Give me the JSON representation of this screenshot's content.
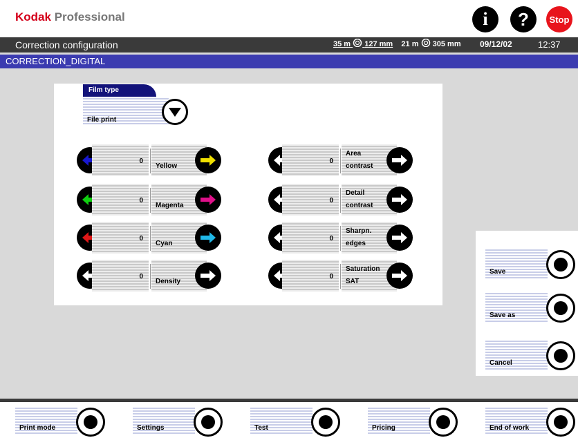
{
  "header": {
    "brand_bold": "Kodak",
    "brand_rest": " Professional",
    "info_icon": "i",
    "help_icon": "?",
    "stop_label": "Stop"
  },
  "titlebar": {
    "title": "Correction configuration",
    "roll1": "35 m",
    "roll1_icon": "film-roll-icon",
    "roll1_size": "127 mm",
    "roll2": "21 m",
    "roll2_icon": "film-roll-icon",
    "roll2_size": "305 mm",
    "date": "09/12/02",
    "time": "12:37"
  },
  "section": {
    "title": "CORRECTION_DIGITAL"
  },
  "film_type": {
    "label": "Film type",
    "value": "File print"
  },
  "corrections_left": [
    {
      "value": "0",
      "label": "Yellow",
      "left_color": "#1818d0",
      "right_color": "#f0e000"
    },
    {
      "value": "0",
      "label": "Magenta",
      "left_color": "#10d010",
      "right_color": "#e0108a"
    },
    {
      "value": "0",
      "label": "Cyan",
      "left_color": "#e01818",
      "right_color": "#20b8e8"
    },
    {
      "value": "0",
      "label": "Density",
      "left_color": "#ffffff",
      "right_color": "#ffffff"
    }
  ],
  "corrections_right": [
    {
      "value": "0",
      "label1": "Area",
      "label2": "contrast"
    },
    {
      "value": "0",
      "label1": "Detail",
      "label2": "contrast"
    },
    {
      "value": "0",
      "label1": "Sharpn.",
      "label2": "edges"
    },
    {
      "value": "0",
      "label1": "Saturation",
      "label2": "SAT"
    }
  ],
  "side_actions": [
    {
      "label": "Save"
    },
    {
      "label": "Save as"
    },
    {
      "label": "Cancel"
    }
  ],
  "bottom_nav": [
    {
      "label": "Print mode"
    },
    {
      "label": "Settings"
    },
    {
      "label": "Test"
    },
    {
      "label": "Pricing"
    },
    {
      "label": "End of work"
    }
  ]
}
